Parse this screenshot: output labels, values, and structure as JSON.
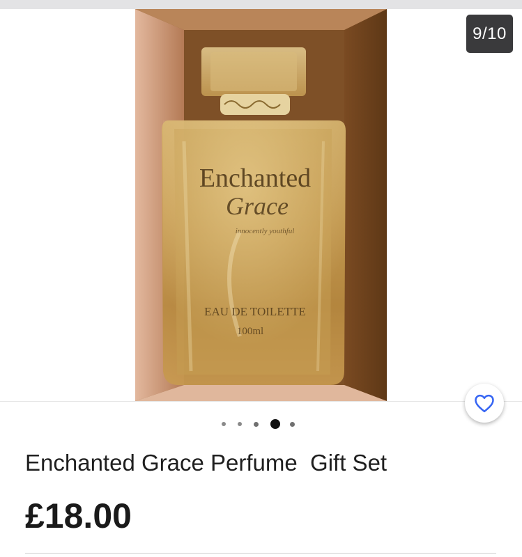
{
  "gallery": {
    "image_counter": "9/10",
    "image_total": 10,
    "active_image_index": 9,
    "pagination_dot_count": 5,
    "active_dot_index": 3,
    "photo_alt": "Enchanted Grace Eau de Toilette perfume bottle",
    "bottle_label": {
      "brand_line1": "Enchanted",
      "brand_line2": "Grace",
      "tagline": "innocently youthful",
      "product_type": "EAU DE TOILETTE",
      "volume": "100ml"
    }
  },
  "watchlist": {
    "icon": "heart-icon",
    "color": "#3665f3"
  },
  "listing": {
    "title": "Enchanted Grace Perfume  Gift Set",
    "price": "£18.00"
  },
  "colors": {
    "accent": "#3665f3",
    "counter_bg": "#3a3a3c",
    "text": "#1f1f1f"
  }
}
